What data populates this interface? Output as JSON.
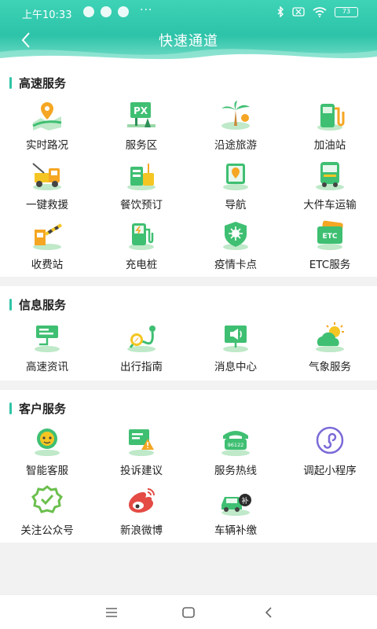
{
  "status": {
    "time": "上午10:33",
    "dots": "···",
    "battery": "73"
  },
  "header": {
    "title": "快速通道"
  },
  "sections": [
    {
      "title": "高速服务",
      "items": [
        {
          "label": "实时路况",
          "icon": "map-route-icon"
        },
        {
          "label": "服务区",
          "icon": "service-area-icon"
        },
        {
          "label": "沿途旅游",
          "icon": "palm-tree-icon"
        },
        {
          "label": "加油站",
          "icon": "fuel-pump-icon"
        },
        {
          "label": "一键救援",
          "icon": "tow-truck-icon"
        },
        {
          "label": "餐饮预订",
          "icon": "food-icon"
        },
        {
          "label": "导航",
          "icon": "navigation-map-icon"
        },
        {
          "label": "大件车运输",
          "icon": "truck-icon"
        },
        {
          "label": "收费站",
          "icon": "toll-gate-icon"
        },
        {
          "label": "充电桩",
          "icon": "charging-pile-icon"
        },
        {
          "label": "疫情卡点",
          "icon": "virus-shield-icon"
        },
        {
          "label": "ETC服务",
          "icon": "etc-card-icon"
        }
      ]
    },
    {
      "title": "信息服务",
      "items": [
        {
          "label": "高速资讯",
          "icon": "news-sign-icon"
        },
        {
          "label": "出行指南",
          "icon": "compass-route-icon"
        },
        {
          "label": "消息中心",
          "icon": "megaphone-board-icon"
        },
        {
          "label": "气象服务",
          "icon": "weather-icon"
        }
      ]
    },
    {
      "title": "客户服务",
      "items": [
        {
          "label": "智能客服",
          "icon": "robot-support-icon"
        },
        {
          "label": "投诉建议",
          "icon": "complaint-icon"
        },
        {
          "label": "服务热线",
          "icon": "hotline-phone-icon"
        },
        {
          "label": "调起小程序",
          "icon": "mini-program-icon"
        },
        {
          "label": "关注公众号",
          "icon": "official-account-icon"
        },
        {
          "label": "新浪微博",
          "icon": "weibo-icon"
        },
        {
          "label": "车辆补缴",
          "icon": "car-payment-icon"
        }
      ]
    }
  ],
  "badges": {
    "hotline": "96122",
    "etc": "ETC",
    "car_pay": "补",
    "service_px": "PX"
  },
  "colors": {
    "accent": "#2fc4a6",
    "green": "#3fbf72",
    "orange": "#f5a623"
  }
}
